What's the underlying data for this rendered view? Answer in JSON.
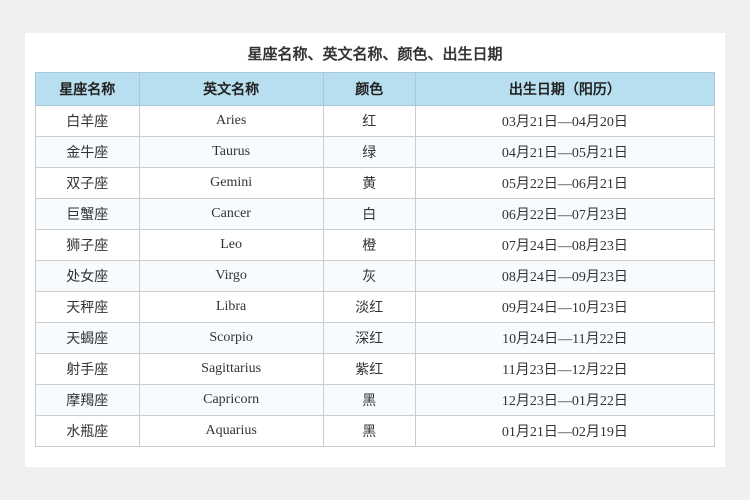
{
  "title": "星座名称、英文名称、颜色、出生日期",
  "headers": {
    "name": "星座名称",
    "english": "英文名称",
    "color": "颜色",
    "date": "出生日期（阳历）"
  },
  "rows": [
    {
      "name": "白羊座",
      "english": "Aries",
      "color": "红",
      "date": "03月21日—04月20日"
    },
    {
      "name": "金牛座",
      "english": "Taurus",
      "color": "绿",
      "date": "04月21日—05月21日"
    },
    {
      "name": "双子座",
      "english": "Gemini",
      "color": "黄",
      "date": "05月22日—06月21日"
    },
    {
      "name": "巨蟹座",
      "english": "Cancer",
      "color": "白",
      "date": "06月22日—07月23日"
    },
    {
      "name": "狮子座",
      "english": "Leo",
      "color": "橙",
      "date": "07月24日—08月23日"
    },
    {
      "name": "处女座",
      "english": "Virgo",
      "color": "灰",
      "date": "08月24日—09月23日"
    },
    {
      "name": "天秤座",
      "english": "Libra",
      "color": "淡红",
      "date": "09月24日—10月23日"
    },
    {
      "name": "天蝎座",
      "english": "Scorpio",
      "color": "深红",
      "date": "10月24日—11月22日"
    },
    {
      "name": "射手座",
      "english": "Sagittarius",
      "color": "紫红",
      "date": "11月23日—12月22日"
    },
    {
      "name": "摩羯座",
      "english": "Capricorn",
      "color": "黑",
      "date": "12月23日—01月22日"
    },
    {
      "name": "水瓶座",
      "english": "Aquarius",
      "color": "黑",
      "date": "01月21日—02月19日"
    }
  ]
}
